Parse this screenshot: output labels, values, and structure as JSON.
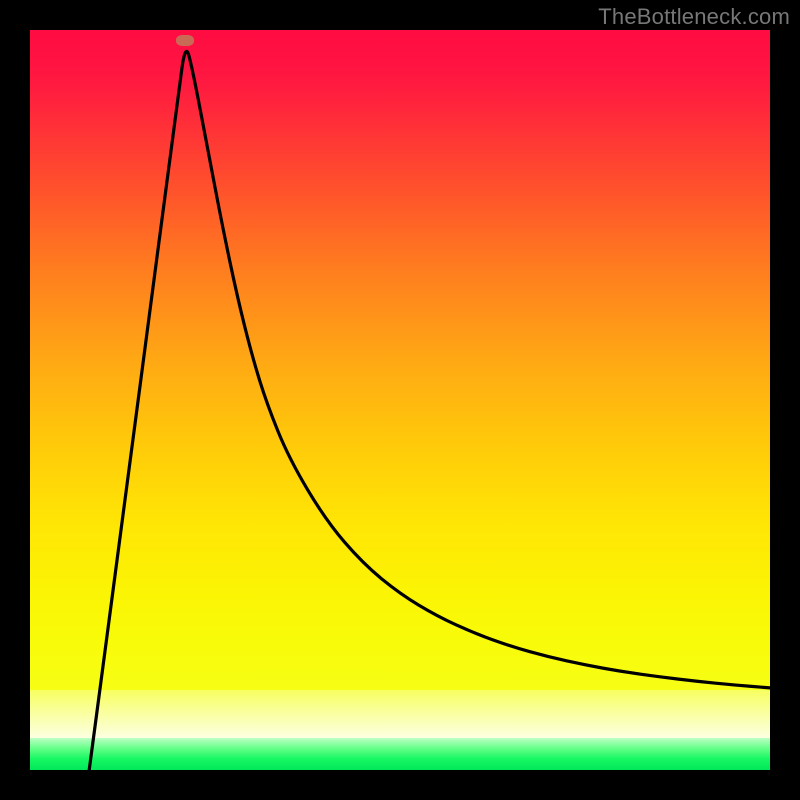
{
  "watermark": "TheBottleneck.com",
  "chart_data": {
    "type": "line",
    "title": "",
    "xlabel": "",
    "ylabel": "",
    "xlim": [
      0,
      100
    ],
    "ylim": [
      0,
      100
    ],
    "grid": false,
    "legend": false,
    "gradient_stops": [
      {
        "pos": 0,
        "color": "#ff0b43"
      },
      {
        "pos": 50,
        "color": "#ffa814"
      },
      {
        "pos": 89,
        "color": "#f8ff60"
      },
      {
        "pos": 95,
        "color": "#fcffe0"
      },
      {
        "pos": 100,
        "color": "#00e858"
      }
    ],
    "min_marker": {
      "x": 21.0,
      "y": 98.6,
      "color": "#c96a56"
    },
    "series": [
      {
        "name": "bottleneck-curve",
        "x": [
          8.0,
          10.0,
          12.0,
          14.0,
          16.0,
          18.0,
          20.0,
          21.0,
          22.0,
          24.0,
          26.0,
          28.0,
          30.0,
          32.0,
          35.0,
          40.0,
          45.0,
          50.0,
          55.0,
          60.0,
          65.0,
          70.0,
          75.0,
          80.0,
          85.0,
          90.0,
          95.0,
          100.0
        ],
        "y": [
          0.0,
          15.0,
          30.2,
          45.3,
          60.5,
          75.7,
          90.8,
          98.4,
          94.5,
          84.0,
          73.5,
          64.0,
          56.0,
          49.5,
          42.1,
          33.7,
          27.9,
          23.8,
          20.8,
          18.5,
          16.7,
          15.3,
          14.2,
          13.3,
          12.6,
          12.0,
          11.5,
          11.1
        ]
      }
    ]
  }
}
